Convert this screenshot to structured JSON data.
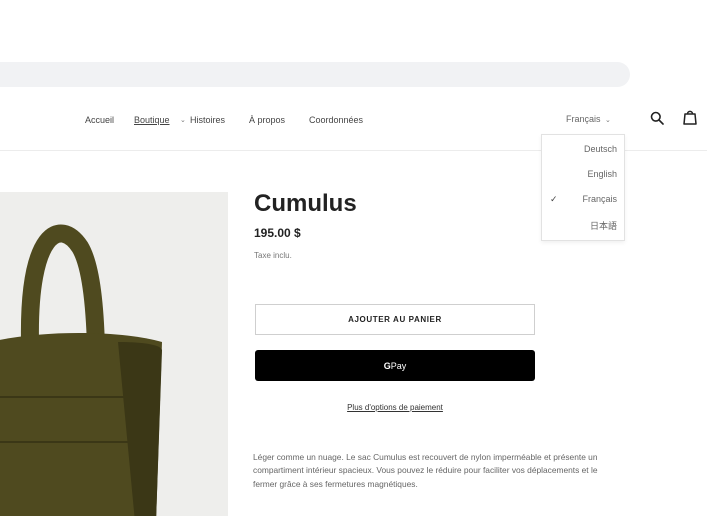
{
  "nav": {
    "items": [
      {
        "label": "Accueil"
      },
      {
        "label": "Boutique"
      },
      {
        "label": "Histoires"
      },
      {
        "label": "À propos"
      },
      {
        "label": "Coordonnées"
      }
    ],
    "chevron": "⌄"
  },
  "header": {
    "language_selected": "Français",
    "language_chevron": "⌄",
    "search_icon": "search-icon",
    "cart_icon": "shopping-bag-icon"
  },
  "language_menu": {
    "items": [
      {
        "label": "Deutsch"
      },
      {
        "label": "English"
      },
      {
        "label": "Français",
        "checked": true
      },
      {
        "label": "日本語"
      }
    ],
    "check_mark": "✓"
  },
  "product": {
    "title": "Cumulus",
    "price": "195.00 $",
    "tax_note": "Taxe inclu.",
    "add_to_cart": "AJOUTER AU PANIER",
    "gpay_g": "G",
    "gpay_label": "Pay",
    "more_options": "Plus d'options de paiement",
    "description": "Léger comme un nuage. Le sac Cumulus est recouvert de nylon imperméable et présente un compartiment intérieur spacieux. Vous pouvez le réduire pour faciliter vos déplacements et le fermer grâce à ses fermetures magnétiques.",
    "image_colors": {
      "bag": "#4f4a1f",
      "bag_shadow": "#3b3716",
      "background": "#eeeeec"
    }
  }
}
